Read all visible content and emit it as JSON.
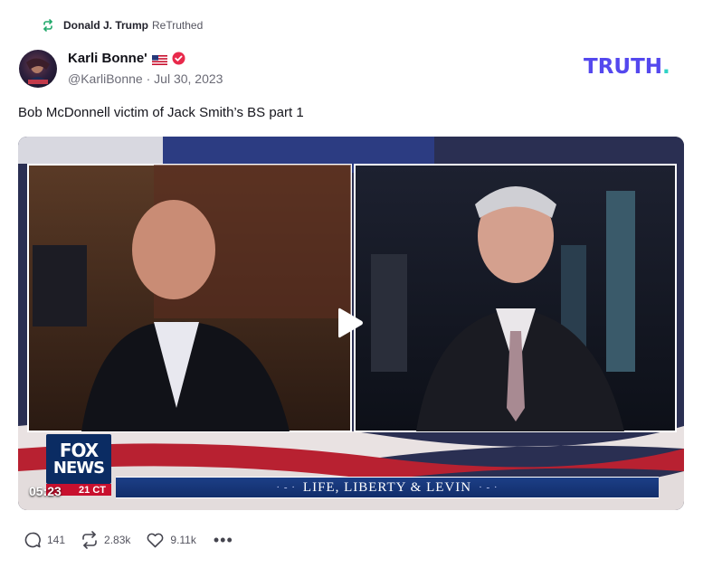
{
  "retruth": {
    "icon": "retruth-icon",
    "user": "Donald J. Trump",
    "action": "ReTruthed"
  },
  "author": {
    "name": "Karli Bonne'",
    "flag": "us-flag-emoji",
    "verified": "verified-badge-icon",
    "handle": "@KarliBonne",
    "separator": "·",
    "date": "Jul 30, 2023"
  },
  "brand": {
    "text": "TRUTH",
    "dot": ".",
    "color": "#5448ee",
    "dot_color": "#2fd3c5"
  },
  "post": {
    "text": "Bob McDonnell victim of Jack Smith’s BS part 1"
  },
  "video": {
    "timestamp": "05:23",
    "network_line1": "FOX",
    "network_line2": "NEWS",
    "clock": "21 CT",
    "show_title": "LIFE, LIBERTY & LEVIN",
    "deco": "· - ·",
    "play_icon": "play-icon"
  },
  "stats": {
    "replies": "141",
    "retruths": "2.83k",
    "likes": "9.11k",
    "more": "•••"
  },
  "colors": {
    "accent": "#5448ee",
    "retruth_green": "#21a96b",
    "verified_red": "#e8294b"
  }
}
